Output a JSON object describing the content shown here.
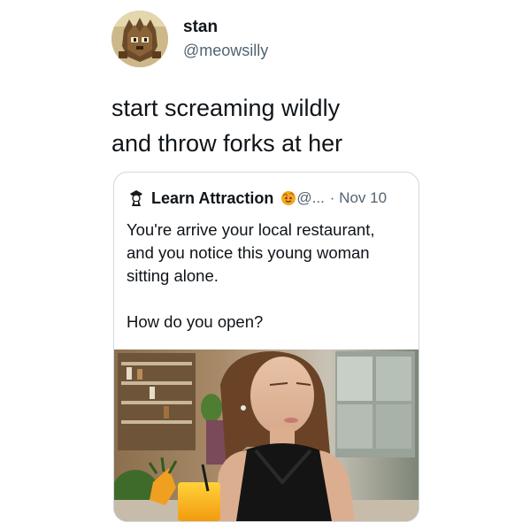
{
  "author": {
    "name": "stan",
    "handle": "@meowsilly",
    "avatar_icon": "pixel-art-creature-avatar"
  },
  "tweet": {
    "text_line1": "start screaming wildly",
    "text_line2": "and throw forks at her"
  },
  "quoted_tweet": {
    "account_name": "Learn Attraction",
    "logo_icon": "black-white-portrait-logo",
    "badge_icon": "orange-emoji-badge-icon",
    "ellipsis": "@...",
    "date": "· Nov 10",
    "body_line1": "You're arrive your local restaurant,",
    "body_line2": "and you notice this young woman",
    "body_line3": "sitting alone.",
    "body_line4": "How do you open?",
    "image_description_icon": "photo-woman-at-restaurant"
  },
  "colors": {
    "text_primary": "#0f1419",
    "text_secondary": "#536471",
    "border": "#cfd9de"
  }
}
